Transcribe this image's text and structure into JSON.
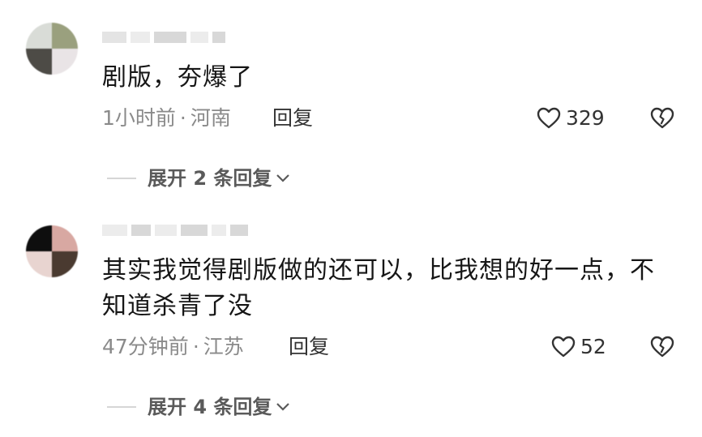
{
  "comments": [
    {
      "text": "剧版，夯爆了",
      "time": "1小时前",
      "sep": "·",
      "location": "河南",
      "reply_label": "回复",
      "likes": "329",
      "expand_label": "展开 2 条回复"
    },
    {
      "text": "其实我觉得剧版做的还可以，比我想的好一点，不\n知道杀青了没",
      "time": "47分钟前",
      "sep": "·",
      "location": "江苏",
      "reply_label": "回复",
      "likes": "52",
      "expand_label": "展开 4 条回复"
    }
  ],
  "icons": {
    "like": "heart-outline-icon",
    "dislike": "broken-heart-icon",
    "expand": "chevron-down-icon"
  },
  "colors": {
    "text": "#161616",
    "meta": "#8a8a8a",
    "reply": "#333333",
    "expand": "#5a5a5a"
  }
}
